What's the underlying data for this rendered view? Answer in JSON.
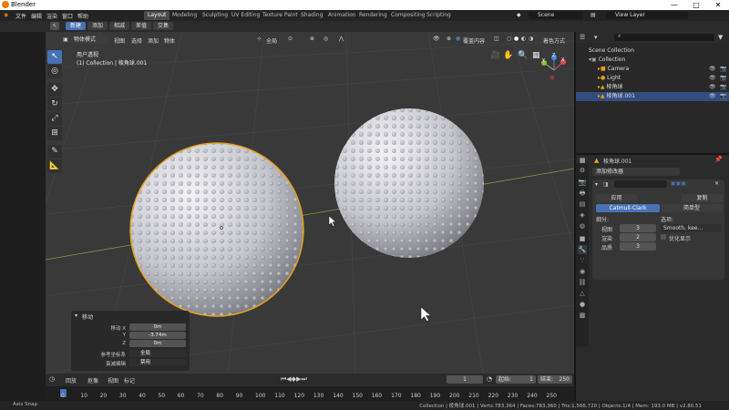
{
  "window": {
    "title": "Blender",
    "minimize": "—",
    "maximize": "□",
    "close": "✕"
  },
  "menubar": {
    "items": [
      "文件",
      "编辑",
      "渲染",
      "窗口",
      "帮助"
    ],
    "workspaces": [
      "Layout",
      "Modeling",
      "Sculpting",
      "UV Editing",
      "Texture Paint",
      "Shading",
      "Animation",
      "Rendering",
      "Compositing",
      "Scripting"
    ],
    "active_workspace": "Layout",
    "scene": "Scene",
    "view_layer": "View Layer"
  },
  "toolsettings": {
    "buttons": [
      "新建",
      "添加",
      "相减",
      "差值",
      "交集"
    ],
    "active": "新建"
  },
  "viewport": {
    "mode": "物体模式",
    "menus": [
      "视图",
      "选择",
      "添加",
      "物体"
    ],
    "orientation": "全局",
    "overlay": "覆盖内容",
    "shading": "着色方式",
    "view_name": "用户透视",
    "collection_info": "(1) Collection | 棱角球.001",
    "gizmo": {
      "x": "X",
      "y": "Y",
      "z": "Z"
    }
  },
  "redo_panel": {
    "title": "移动",
    "labels": [
      "移动 X",
      "Y",
      "Z",
      "参考坐标系",
      "衰减编辑"
    ],
    "values": [
      "0m",
      "-3.74m",
      "0m",
      "全局",
      "禁用"
    ]
  },
  "outliner": {
    "search_placeholder": "",
    "rows": [
      "Scene Collection",
      "Collection",
      "Camera",
      "Light",
      "棱角球",
      "棱角球.001"
    ]
  },
  "properties": {
    "object_name": "棱角球.001",
    "add_modifier": "添加修改器",
    "apply": "应用",
    "copy": "复制",
    "catmull": "Catmull-Clark",
    "simple": "简单型",
    "subdiv_label": "细分:",
    "options_label": "选项:",
    "viewport_label": "视图",
    "viewport_value": "3",
    "render_label": "渲染",
    "render_value": "2",
    "quality_label": "品质",
    "quality_value": "3",
    "uv_smooth": "Smooth, kee...",
    "optimal": "优化显示"
  },
  "timeline": {
    "menus": [
      "回放",
      "抠像",
      "视图",
      "标记"
    ],
    "frame": "1",
    "start_label": "起始",
    "start": "1",
    "end_label": "结束",
    "end": "250",
    "ticks": [
      "0",
      "10",
      "20",
      "30",
      "40",
      "50",
      "60",
      "70",
      "80",
      "90",
      "100",
      "110",
      "120",
      "130",
      "140",
      "150",
      "160",
      "170",
      "180",
      "190",
      "200",
      "210",
      "220",
      "230",
      "240",
      "250"
    ]
  },
  "statusbar": {
    "left": "Axis Snap",
    "right": "Collection | 棱角球.001 | Verts:783,364 | Faces:783,360 | Tris:1,566,720 | Objects:1/4 | Mem: 193.0 MB | v2.80.51"
  },
  "colors": {
    "accent": "#4772b3",
    "selection": "#e8a01c",
    "grid": "#4a4a4a",
    "x_axis": "#8a9a3a"
  }
}
